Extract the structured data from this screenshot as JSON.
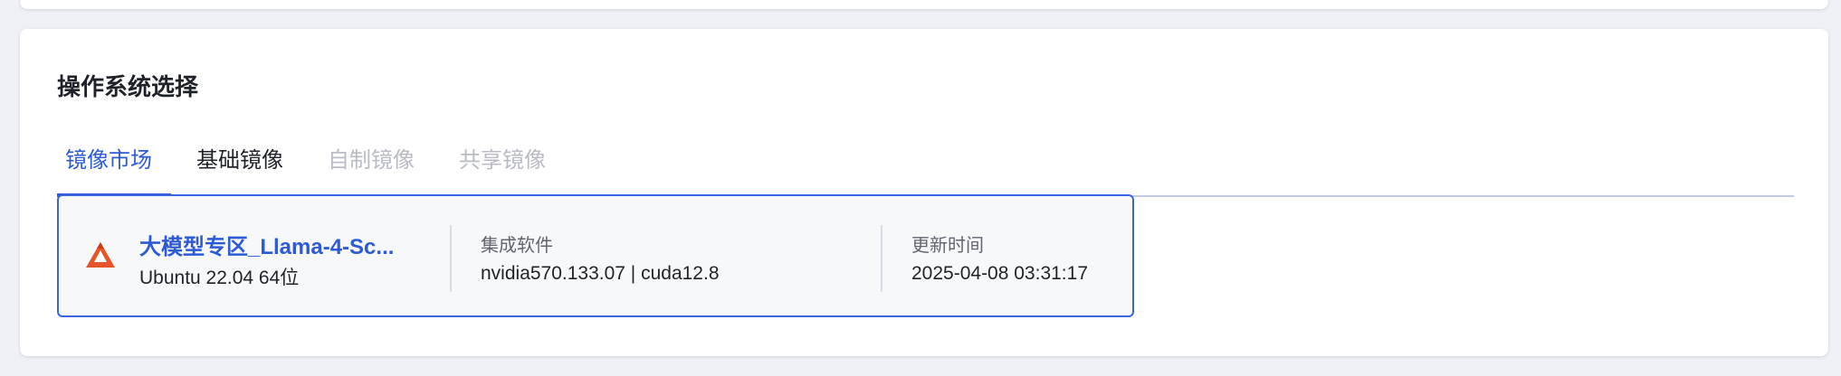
{
  "section": {
    "title": "操作系统选择"
  },
  "tabs": [
    {
      "label": "镜像市场",
      "state": "active"
    },
    {
      "label": "基础镜像",
      "state": "normal"
    },
    {
      "label": "自制镜像",
      "state": "disabled"
    },
    {
      "label": "共享镜像",
      "state": "disabled"
    }
  ],
  "image_card": {
    "logo_icon": "orange-triangle-logo-icon",
    "name": "大模型专区_Llama-4-Sc...",
    "os": "Ubuntu 22.04 64位",
    "software_label": "集成软件",
    "software_value": "nvidia570.133.07  |  cuda12.8",
    "updated_label": "更新时间",
    "updated_value": "2025-04-08 03:31:17"
  },
  "colors": {
    "accent": "#2d5bd8",
    "logo": "#e8542a",
    "disabled_text": "#b9bcc4"
  }
}
